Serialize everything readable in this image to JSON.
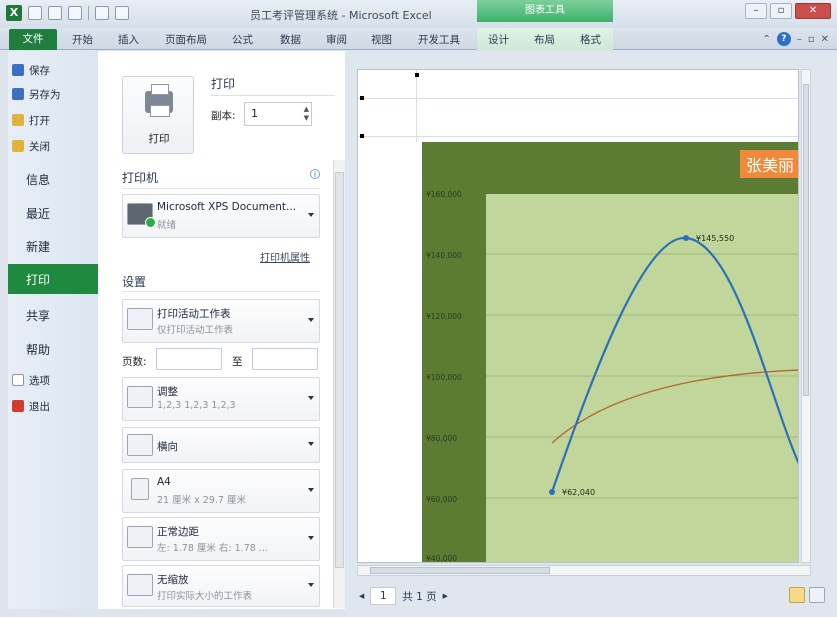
{
  "window": {
    "title": "员工考评管理系统 - Microsoft Excel",
    "context_tab": "图表工具",
    "buttons": {
      "minimize": "–",
      "restore": "▫",
      "close": "✕"
    }
  },
  "ribbon": {
    "file_tab": "文件",
    "tabs": [
      "开始",
      "插入",
      "页面布局",
      "公式",
      "数据",
      "审阅",
      "视图",
      "开发工具",
      "设计",
      "布局",
      "格式"
    ],
    "help": "?"
  },
  "backstage": {
    "small_items": [
      {
        "label": "保存",
        "icon": "save-icon",
        "color": "#3a6fc4"
      },
      {
        "label": "另存为",
        "icon": "save-as-icon",
        "color": "#3a6fc4"
      },
      {
        "label": "打开",
        "icon": "open-folder-icon",
        "color": "#e0b43c"
      },
      {
        "label": "关闭",
        "icon": "close-folder-icon",
        "color": "#e0b43c"
      }
    ],
    "big_items": [
      "信息",
      "最近",
      "新建"
    ],
    "active": "打印",
    "lower_items": [
      "共享",
      "帮助"
    ],
    "bottom_items": [
      {
        "label": "选项",
        "icon": "options-icon",
        "color": "#ffffff"
      },
      {
        "label": "退出",
        "icon": "exit-icon",
        "color": "#d23b2e"
      }
    ]
  },
  "print": {
    "section_title": "打印",
    "print_button": "打印",
    "copies_label": "副本:",
    "copies_value": "1",
    "printer_section": "打印机",
    "printer_name": "Microsoft XPS Document...",
    "printer_status": "就绪",
    "printer_props": "打印机属性",
    "settings_section": "设置",
    "settings": [
      {
        "l1": "打印活动工作表",
        "l2": "仅打印活动工作表"
      },
      {
        "l1": "调整",
        "l2": "1,2,3    1,2,3    1,2,3"
      },
      {
        "l1": "横向",
        "l2": ""
      },
      {
        "l1": "A4",
        "l2": "21 厘米 x 29.7 厘米"
      },
      {
        "l1": "正常边距",
        "l2": "左: 1.78 厘米    右: 1.78 ..."
      },
      {
        "l1": "无缩放",
        "l2": "打印实际大小的工作表"
      }
    ],
    "pages_label": "页数:",
    "pages_to": "至"
  },
  "preview": {
    "page_current": "1",
    "page_total": "共 1 页",
    "nav_prev": "◂",
    "nav_next": "▸"
  },
  "chart_data": {
    "type": "line",
    "title": "张美丽",
    "y_ticks": [
      "¥160,000",
      "¥140,000",
      "¥120,000",
      "¥100,000",
      "¥80,000",
      "¥60,000",
      "¥40,000"
    ],
    "ylim": [
      40000,
      160000
    ],
    "series": [
      {
        "values": [
          62040,
          145550,
          60000
        ],
        "color": "#2e6fb8"
      },
      {
        "values": [
          78000,
          102000
        ],
        "color": "#b5652f"
      }
    ],
    "data_labels": [
      "¥62,040",
      "¥145,550"
    ]
  }
}
